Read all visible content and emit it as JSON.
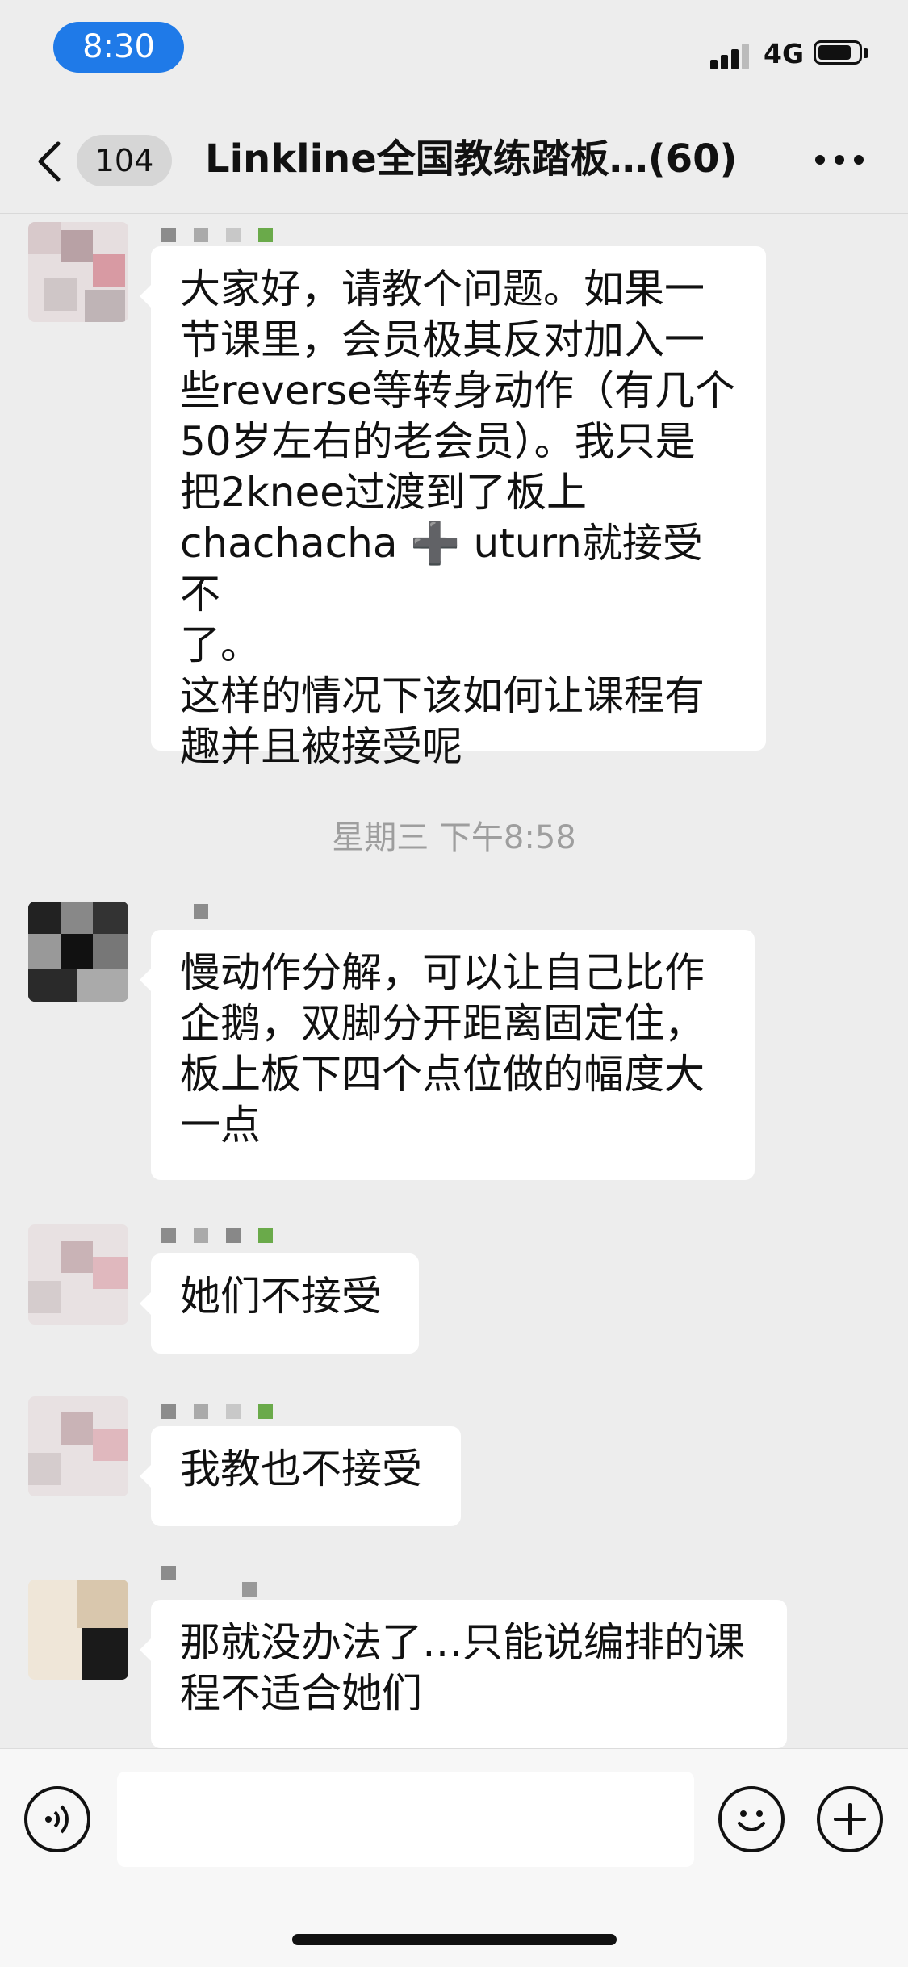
{
  "status_bar": {
    "time": "8:30",
    "network": "4G"
  },
  "nav": {
    "unread_count": "104",
    "title": "Linkline全国教练踏板…(60)"
  },
  "timestamp": "星期三 下午8:58",
  "messages": [
    {
      "text": "大家好，请教个问题。如果一\n节课里，会员极其反对加入一\n些reverse等转身动作（有几个\n50岁左右的老会员）。我只是\n把2knee过渡到了板上\nchachacha ➕ uturn就接受不\n了。\n这样的情况下该如何让课程有\n趣并且被接受呢"
    },
    {
      "text": "慢动作分解，可以让自己比作\n企鹅，双脚分开距离固定住，\n板上板下四个点位做的幅度大\n一点"
    },
    {
      "text": "她们不接受"
    },
    {
      "text": "我教也不接受"
    },
    {
      "text": "那就没办法了…只能说编排的课\n程不适合她们"
    }
  ]
}
